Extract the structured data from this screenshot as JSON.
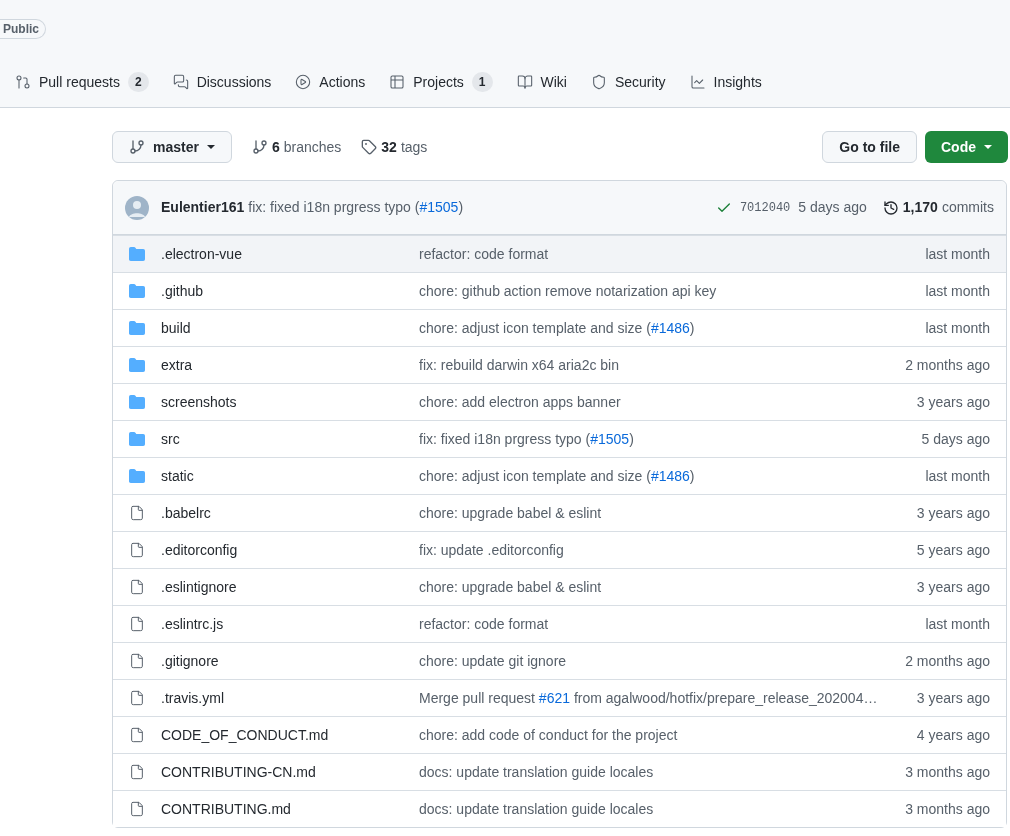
{
  "repo": {
    "visibility": "Public"
  },
  "tabs": [
    {
      "label": "Pull requests",
      "count": "2"
    },
    {
      "label": "Discussions"
    },
    {
      "label": "Actions"
    },
    {
      "label": "Projects",
      "count": "1"
    },
    {
      "label": "Wiki"
    },
    {
      "label": "Security"
    },
    {
      "label": "Insights"
    }
  ],
  "branch": {
    "name": "master",
    "branches_count": "6",
    "branches_label": "branches",
    "tags_count": "32",
    "tags_label": "tags"
  },
  "buttons": {
    "go_to_file": "Go to file",
    "code": "Code"
  },
  "latest_commit": {
    "author": "Eulentier161",
    "message": "fix: fixed i18n prgress typo (",
    "link": "#1505",
    "after": ")",
    "hash": "7012040",
    "time": "5 days ago",
    "commits_count": "1,170",
    "commits_label": "commits"
  },
  "files": [
    {
      "kind": "folder",
      "name": ".electron-vue",
      "message": "refactor: code format",
      "time": "last month",
      "highlighted": true
    },
    {
      "kind": "folder",
      "name": ".github",
      "message": "chore: github action remove notarization api key",
      "time": "last month",
      "highlighted": false
    },
    {
      "kind": "folder",
      "name": "build",
      "message": "chore: adjust icon template and size (",
      "link": "#1486",
      "after": ")",
      "time": "last month",
      "highlighted": false
    },
    {
      "kind": "folder",
      "name": "extra",
      "message": "fix: rebuild darwin x64 aria2c bin",
      "time": "2 months ago",
      "highlighted": false
    },
    {
      "kind": "folder",
      "name": "screenshots",
      "message": "chore: add electron apps banner",
      "time": "3 years ago",
      "highlighted": false
    },
    {
      "kind": "folder",
      "name": "src",
      "message": "fix: fixed i18n prgress typo (",
      "link": "#1505",
      "after": ")",
      "time": "5 days ago",
      "highlighted": false
    },
    {
      "kind": "folder",
      "name": "static",
      "message": "chore: adjust icon template and size (",
      "link": "#1486",
      "after": ")",
      "time": "last month",
      "highlighted": false
    },
    {
      "kind": "file",
      "name": ".babelrc",
      "message": "chore: upgrade babel & eslint",
      "time": "3 years ago",
      "highlighted": false
    },
    {
      "kind": "file",
      "name": ".editorconfig",
      "message": "fix: update .editorconfig",
      "time": "5 years ago",
      "highlighted": false
    },
    {
      "kind": "file",
      "name": ".eslintignore",
      "message": "chore: upgrade babel & eslint",
      "time": "3 years ago",
      "highlighted": false
    },
    {
      "kind": "file",
      "name": ".eslintrc.js",
      "message": "refactor: code format",
      "time": "last month",
      "highlighted": false
    },
    {
      "kind": "file",
      "name": ".gitignore",
      "message": "chore: update git ignore",
      "time": "2 months ago",
      "highlighted": false
    },
    {
      "kind": "file",
      "name": ".travis.yml",
      "message": "Merge pull request ",
      "link": "#621",
      "after": " from agalwood/hotfix/prepare_release_202004…",
      "time": "3 years ago",
      "highlighted": false
    },
    {
      "kind": "file",
      "name": "CODE_OF_CONDUCT.md",
      "message": "chore: add code of conduct for the project",
      "time": "4 years ago",
      "highlighted": false
    },
    {
      "kind": "file",
      "name": "CONTRIBUTING-CN.md",
      "message": "docs: update translation guide locales",
      "time": "3 months ago",
      "highlighted": false
    },
    {
      "kind": "file",
      "name": "CONTRIBUTING.md",
      "message": "docs: update translation guide locales",
      "time": "3 months ago",
      "highlighted": false
    }
  ]
}
